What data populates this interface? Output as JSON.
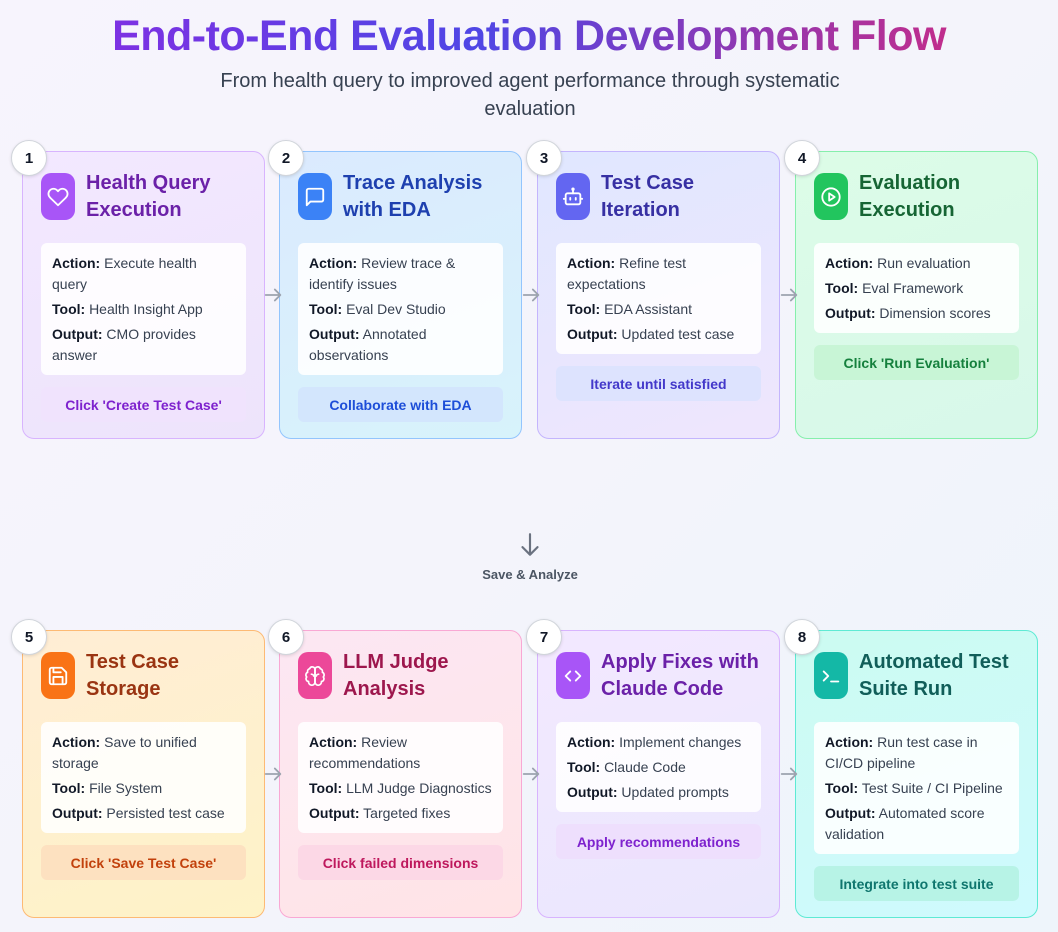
{
  "header": {
    "title": "End-to-End Evaluation Development Flow",
    "subtitle": "From health query to improved agent performance through systematic evaluation"
  },
  "flow_label": "Save & Analyze",
  "labels": {
    "action": "Action:",
    "tool": "Tool:",
    "output": "Output:"
  },
  "steps": [
    {
      "number": "1",
      "title": "Health Query Execution",
      "icon": "heart-icon",
      "action": "Execute health query",
      "tool": "Health Insight App",
      "output": "CMO provides answer",
      "cta": "Click 'Create Test Case'",
      "theme": "#a855f7"
    },
    {
      "number": "2",
      "title": "Trace Analysis with EDA",
      "icon": "chat-bubble-icon",
      "action": "Review trace & identify issues",
      "tool": "Eval Dev Studio",
      "output": "Annotated observations",
      "cta": "Collaborate with EDA",
      "theme": "#3b82f6"
    },
    {
      "number": "3",
      "title": "Test Case Iteration",
      "icon": "robot-icon",
      "action": "Refine test expectations",
      "tool": "EDA Assistant",
      "output": "Updated test case",
      "cta": "Iterate until satisfied",
      "theme": "#6366f1"
    },
    {
      "number": "4",
      "title": "Evaluation Execution",
      "icon": "play-circle-icon",
      "action": "Run evaluation",
      "tool": "Eval Framework",
      "output": "Dimension scores",
      "cta": "Click 'Run Evaluation'",
      "theme": "#22c55e"
    },
    {
      "number": "5",
      "title": "Test Case Storage",
      "icon": "save-icon",
      "action": "Save to unified storage",
      "tool": "File System",
      "output": "Persisted test case",
      "cta": "Click 'Save Test Case'",
      "theme": "#f97316"
    },
    {
      "number": "6",
      "title": "LLM Judge Analysis",
      "icon": "brain-icon",
      "action": "Review recommendations",
      "tool": "LLM Judge Diagnostics",
      "output": "Targeted fixes",
      "cta": "Click failed dimensions",
      "theme": "#ec4899"
    },
    {
      "number": "7",
      "title": "Apply Fixes with Claude Code",
      "icon": "code-icon",
      "action": "Implement changes",
      "tool": "Claude Code",
      "output": "Updated prompts",
      "cta": "Apply recommendations",
      "theme": "#a855f7"
    },
    {
      "number": "8",
      "title": "Automated Test Suite Run",
      "icon": "terminal-icon",
      "action": "Run test case in CI/CD pipeline",
      "tool": "Test Suite / CI Pipeline",
      "output": "Automated score validation",
      "cta": "Integrate into test suite",
      "theme": "#14b8a6"
    }
  ]
}
